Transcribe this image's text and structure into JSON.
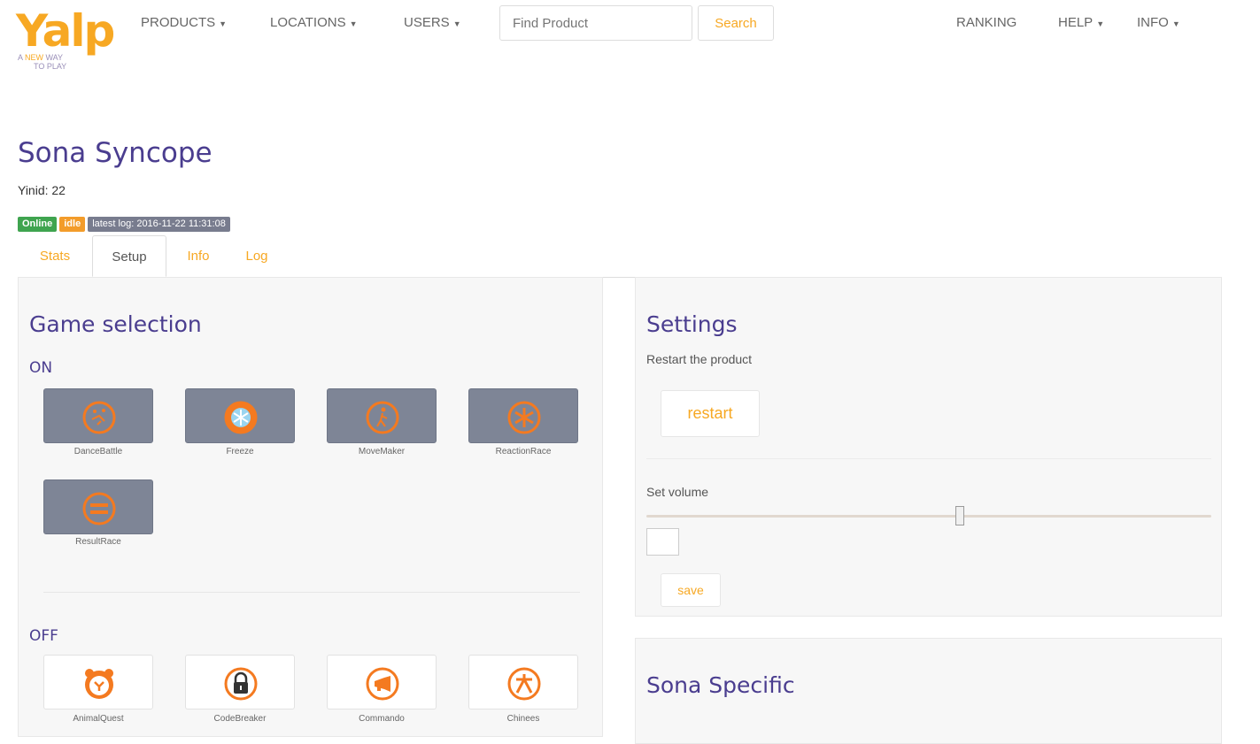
{
  "logo": {
    "word": "Yalp",
    "tagline_a": "A ",
    "tagline_hl": "NEW",
    "tagline_b": " WAY",
    "tagline_c": "TO PLAY"
  },
  "nav": {
    "products": "PRODUCTS",
    "locations": "LOCATIONS",
    "users": "USERS",
    "search_placeholder": "Find Product",
    "search_button": "Search",
    "ranking": "RANKING",
    "help": "HELP",
    "info": "INFO",
    "caret": "▼"
  },
  "page": {
    "title": "Sona Syncope",
    "yinid": "Yinid: 22",
    "badges": {
      "online": "Online",
      "idle": "idle",
      "latest_log": "latest log: 2016-11-22 11:31:08"
    }
  },
  "tabs": [
    "Stats",
    "Setup",
    "Info",
    "Log"
  ],
  "game_selection": {
    "title": "Game selection",
    "on_label": "ON",
    "off_label": "OFF",
    "on_games": [
      {
        "name": "DanceBattle",
        "icon": "dance-icon"
      },
      {
        "name": "Freeze",
        "icon": "snowflake-icon"
      },
      {
        "name": "MoveMaker",
        "icon": "walker-icon"
      },
      {
        "name": "ReactionRace",
        "icon": "asterisk-icon"
      },
      {
        "name": "ResultRace",
        "icon": "equals-icon"
      }
    ],
    "off_games": [
      {
        "name": "AnimalQuest",
        "icon": "bear-icon"
      },
      {
        "name": "CodeBreaker",
        "icon": "padlock-icon"
      },
      {
        "name": "Commando",
        "icon": "megaphone-icon"
      },
      {
        "name": "Chinees",
        "icon": "chinese-character-icon"
      }
    ]
  },
  "settings": {
    "title": "Settings",
    "restart_desc": "Restart the product",
    "restart_button": "restart",
    "volume_label": "Set volume",
    "volume_value": "",
    "volume_level": 0.555,
    "save_button": "save"
  },
  "sona_specific": {
    "title": "Sona Specific"
  },
  "colors": {
    "accent": "#f7a823",
    "heading": "#4a3d8f",
    "online": "#3fa44f",
    "idle": "#f39c2a",
    "tile_on": "#7e8596"
  }
}
